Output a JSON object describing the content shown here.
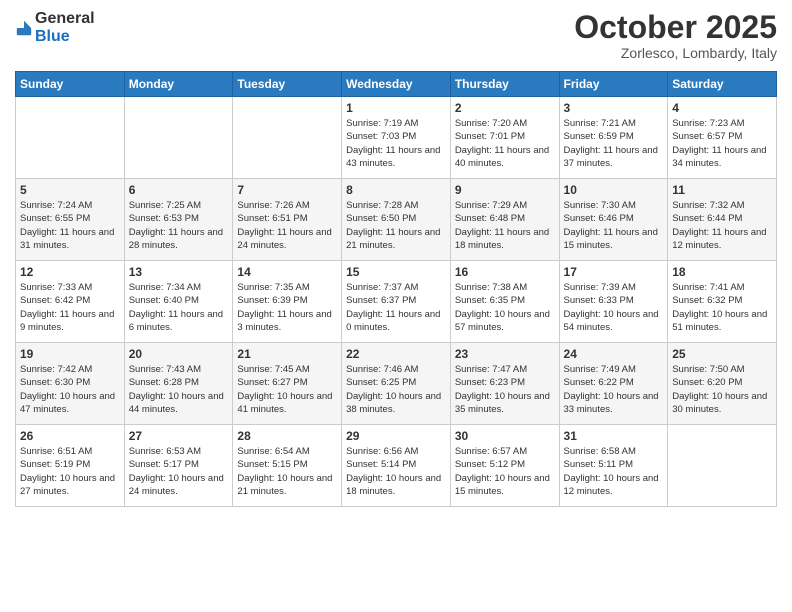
{
  "header": {
    "logo": {
      "general": "General",
      "blue": "Blue"
    },
    "title": "October 2025",
    "location": "Zorlesco, Lombardy, Italy"
  },
  "weekdays": [
    "Sunday",
    "Monday",
    "Tuesday",
    "Wednesday",
    "Thursday",
    "Friday",
    "Saturday"
  ],
  "weeks": [
    [
      {
        "day": "",
        "info": ""
      },
      {
        "day": "",
        "info": ""
      },
      {
        "day": "",
        "info": ""
      },
      {
        "day": "1",
        "info": "Sunrise: 7:19 AM\nSunset: 7:03 PM\nDaylight: 11 hours and 43 minutes."
      },
      {
        "day": "2",
        "info": "Sunrise: 7:20 AM\nSunset: 7:01 PM\nDaylight: 11 hours and 40 minutes."
      },
      {
        "day": "3",
        "info": "Sunrise: 7:21 AM\nSunset: 6:59 PM\nDaylight: 11 hours and 37 minutes."
      },
      {
        "day": "4",
        "info": "Sunrise: 7:23 AM\nSunset: 6:57 PM\nDaylight: 11 hours and 34 minutes."
      }
    ],
    [
      {
        "day": "5",
        "info": "Sunrise: 7:24 AM\nSunset: 6:55 PM\nDaylight: 11 hours and 31 minutes."
      },
      {
        "day": "6",
        "info": "Sunrise: 7:25 AM\nSunset: 6:53 PM\nDaylight: 11 hours and 28 minutes."
      },
      {
        "day": "7",
        "info": "Sunrise: 7:26 AM\nSunset: 6:51 PM\nDaylight: 11 hours and 24 minutes."
      },
      {
        "day": "8",
        "info": "Sunrise: 7:28 AM\nSunset: 6:50 PM\nDaylight: 11 hours and 21 minutes."
      },
      {
        "day": "9",
        "info": "Sunrise: 7:29 AM\nSunset: 6:48 PM\nDaylight: 11 hours and 18 minutes."
      },
      {
        "day": "10",
        "info": "Sunrise: 7:30 AM\nSunset: 6:46 PM\nDaylight: 11 hours and 15 minutes."
      },
      {
        "day": "11",
        "info": "Sunrise: 7:32 AM\nSunset: 6:44 PM\nDaylight: 11 hours and 12 minutes."
      }
    ],
    [
      {
        "day": "12",
        "info": "Sunrise: 7:33 AM\nSunset: 6:42 PM\nDaylight: 11 hours and 9 minutes."
      },
      {
        "day": "13",
        "info": "Sunrise: 7:34 AM\nSunset: 6:40 PM\nDaylight: 11 hours and 6 minutes."
      },
      {
        "day": "14",
        "info": "Sunrise: 7:35 AM\nSunset: 6:39 PM\nDaylight: 11 hours and 3 minutes."
      },
      {
        "day": "15",
        "info": "Sunrise: 7:37 AM\nSunset: 6:37 PM\nDaylight: 11 hours and 0 minutes."
      },
      {
        "day": "16",
        "info": "Sunrise: 7:38 AM\nSunset: 6:35 PM\nDaylight: 10 hours and 57 minutes."
      },
      {
        "day": "17",
        "info": "Sunrise: 7:39 AM\nSunset: 6:33 PM\nDaylight: 10 hours and 54 minutes."
      },
      {
        "day": "18",
        "info": "Sunrise: 7:41 AM\nSunset: 6:32 PM\nDaylight: 10 hours and 51 minutes."
      }
    ],
    [
      {
        "day": "19",
        "info": "Sunrise: 7:42 AM\nSunset: 6:30 PM\nDaylight: 10 hours and 47 minutes."
      },
      {
        "day": "20",
        "info": "Sunrise: 7:43 AM\nSunset: 6:28 PM\nDaylight: 10 hours and 44 minutes."
      },
      {
        "day": "21",
        "info": "Sunrise: 7:45 AM\nSunset: 6:27 PM\nDaylight: 10 hours and 41 minutes."
      },
      {
        "day": "22",
        "info": "Sunrise: 7:46 AM\nSunset: 6:25 PM\nDaylight: 10 hours and 38 minutes."
      },
      {
        "day": "23",
        "info": "Sunrise: 7:47 AM\nSunset: 6:23 PM\nDaylight: 10 hours and 35 minutes."
      },
      {
        "day": "24",
        "info": "Sunrise: 7:49 AM\nSunset: 6:22 PM\nDaylight: 10 hours and 33 minutes."
      },
      {
        "day": "25",
        "info": "Sunrise: 7:50 AM\nSunset: 6:20 PM\nDaylight: 10 hours and 30 minutes."
      }
    ],
    [
      {
        "day": "26",
        "info": "Sunrise: 6:51 AM\nSunset: 5:19 PM\nDaylight: 10 hours and 27 minutes."
      },
      {
        "day": "27",
        "info": "Sunrise: 6:53 AM\nSunset: 5:17 PM\nDaylight: 10 hours and 24 minutes."
      },
      {
        "day": "28",
        "info": "Sunrise: 6:54 AM\nSunset: 5:15 PM\nDaylight: 10 hours and 21 minutes."
      },
      {
        "day": "29",
        "info": "Sunrise: 6:56 AM\nSunset: 5:14 PM\nDaylight: 10 hours and 18 minutes."
      },
      {
        "day": "30",
        "info": "Sunrise: 6:57 AM\nSunset: 5:12 PM\nDaylight: 10 hours and 15 minutes."
      },
      {
        "day": "31",
        "info": "Sunrise: 6:58 AM\nSunset: 5:11 PM\nDaylight: 10 hours and 12 minutes."
      },
      {
        "day": "",
        "info": ""
      }
    ]
  ]
}
